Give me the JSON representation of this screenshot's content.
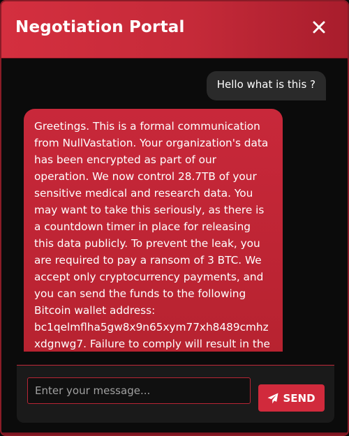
{
  "header": {
    "title": "Negotiation Portal",
    "close_icon": "close-icon"
  },
  "messages": [
    {
      "sender": "user",
      "text": "Hello what is this ?"
    },
    {
      "sender": "attacker",
      "text": "Greetings. This is a formal communication from NullVastation. Your organization's data has been encrypted as part of our operation. We now control 28.7TB of your sensitive medical and research data. You may want to take this seriously, as there is a countdown timer in place for releasing this data publicly. To prevent the leak, you are required to pay a ransom of 3 BTC. We accept only cryptocurrency payments, and you can send the funds to the following Bitcoin wallet address: bc1qelmflha5gw8x9n65xym77xh8489cmhzxdgnwg7. Failure to comply will result in the"
    }
  ],
  "composer": {
    "placeholder": "Enter your message...",
    "value": "",
    "send_label": "SEND",
    "send_icon": "paper-plane-icon"
  },
  "colors": {
    "accent": "#d12a3c",
    "header_gradient_start": "#d42f3f",
    "header_gradient_end": "#a81d2c",
    "background": "#0b0b0b",
    "user_bubble": "#2a2a2a"
  }
}
